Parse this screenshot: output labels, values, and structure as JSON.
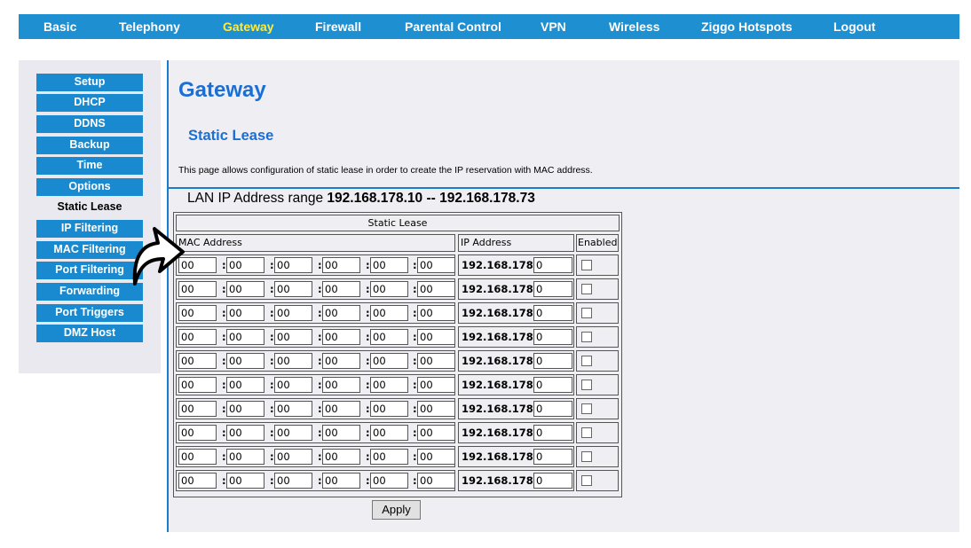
{
  "topnav": {
    "items": [
      {
        "label": "Basic",
        "active": false
      },
      {
        "label": "Telephony",
        "active": false
      },
      {
        "label": "Gateway",
        "active": true
      },
      {
        "label": "Firewall",
        "active": false
      },
      {
        "label": "Parental Control",
        "active": false
      },
      {
        "label": "VPN",
        "active": false
      },
      {
        "label": "Wireless",
        "active": false
      },
      {
        "label": "Ziggo Hotspots",
        "active": false
      },
      {
        "label": "Logout",
        "active": false
      }
    ]
  },
  "sidebar": {
    "items": [
      {
        "label": "Setup",
        "active": false
      },
      {
        "label": "DHCP",
        "active": false
      },
      {
        "label": "DDNS",
        "active": false
      },
      {
        "label": "Backup",
        "active": false
      },
      {
        "label": "Time",
        "active": false
      },
      {
        "label": "Options",
        "active": false
      },
      {
        "label": "Static Lease",
        "active": true
      },
      {
        "label": "IP Filtering",
        "active": false
      },
      {
        "label": "MAC Filtering",
        "active": false
      },
      {
        "label": "Port Filtering",
        "active": false
      },
      {
        "label": "Forwarding",
        "active": false
      },
      {
        "label": "Port Triggers",
        "active": false
      },
      {
        "label": "DMZ Host",
        "active": false
      }
    ]
  },
  "main": {
    "title": "Gateway",
    "section_title": "Static Lease",
    "description": "This page allows configuration of static lease in order to create the IP reservation with MAC address.",
    "range_label": "LAN IP Address range",
    "range_value": "192.168.178.10 -- 192.168.178.73",
    "table": {
      "caption": "Static Lease",
      "headers": {
        "mac": "MAC Address",
        "ip": "IP Address",
        "enabled": "Enabled"
      },
      "ip_prefix": "192.168.178.",
      "rows": [
        {
          "mac": [
            "00",
            "00",
            "00",
            "00",
            "00",
            "00"
          ],
          "ip_last": "0",
          "enabled": false
        },
        {
          "mac": [
            "00",
            "00",
            "00",
            "00",
            "00",
            "00"
          ],
          "ip_last": "0",
          "enabled": false
        },
        {
          "mac": [
            "00",
            "00",
            "00",
            "00",
            "00",
            "00"
          ],
          "ip_last": "0",
          "enabled": false
        },
        {
          "mac": [
            "00",
            "00",
            "00",
            "00",
            "00",
            "00"
          ],
          "ip_last": "0",
          "enabled": false
        },
        {
          "mac": [
            "00",
            "00",
            "00",
            "00",
            "00",
            "00"
          ],
          "ip_last": "0",
          "enabled": false
        },
        {
          "mac": [
            "00",
            "00",
            "00",
            "00",
            "00",
            "00"
          ],
          "ip_last": "0",
          "enabled": false
        },
        {
          "mac": [
            "00",
            "00",
            "00",
            "00",
            "00",
            "00"
          ],
          "ip_last": "0",
          "enabled": false
        },
        {
          "mac": [
            "00",
            "00",
            "00",
            "00",
            "00",
            "00"
          ],
          "ip_last": "0",
          "enabled": false
        },
        {
          "mac": [
            "00",
            "00",
            "00",
            "00",
            "00",
            "00"
          ],
          "ip_last": "0",
          "enabled": false
        },
        {
          "mac": [
            "00",
            "00",
            "00",
            "00",
            "00",
            "00"
          ],
          "ip_last": "0",
          "enabled": false
        }
      ]
    },
    "apply_label": "Apply"
  },
  "colors": {
    "nav_bg": "#1e90d2",
    "nav_active": "#ffeb3b",
    "title_blue": "#1a6fd6",
    "panel_bg": "#eeeef3"
  },
  "overlay": {
    "icon": "pointer-arrow-icon"
  }
}
